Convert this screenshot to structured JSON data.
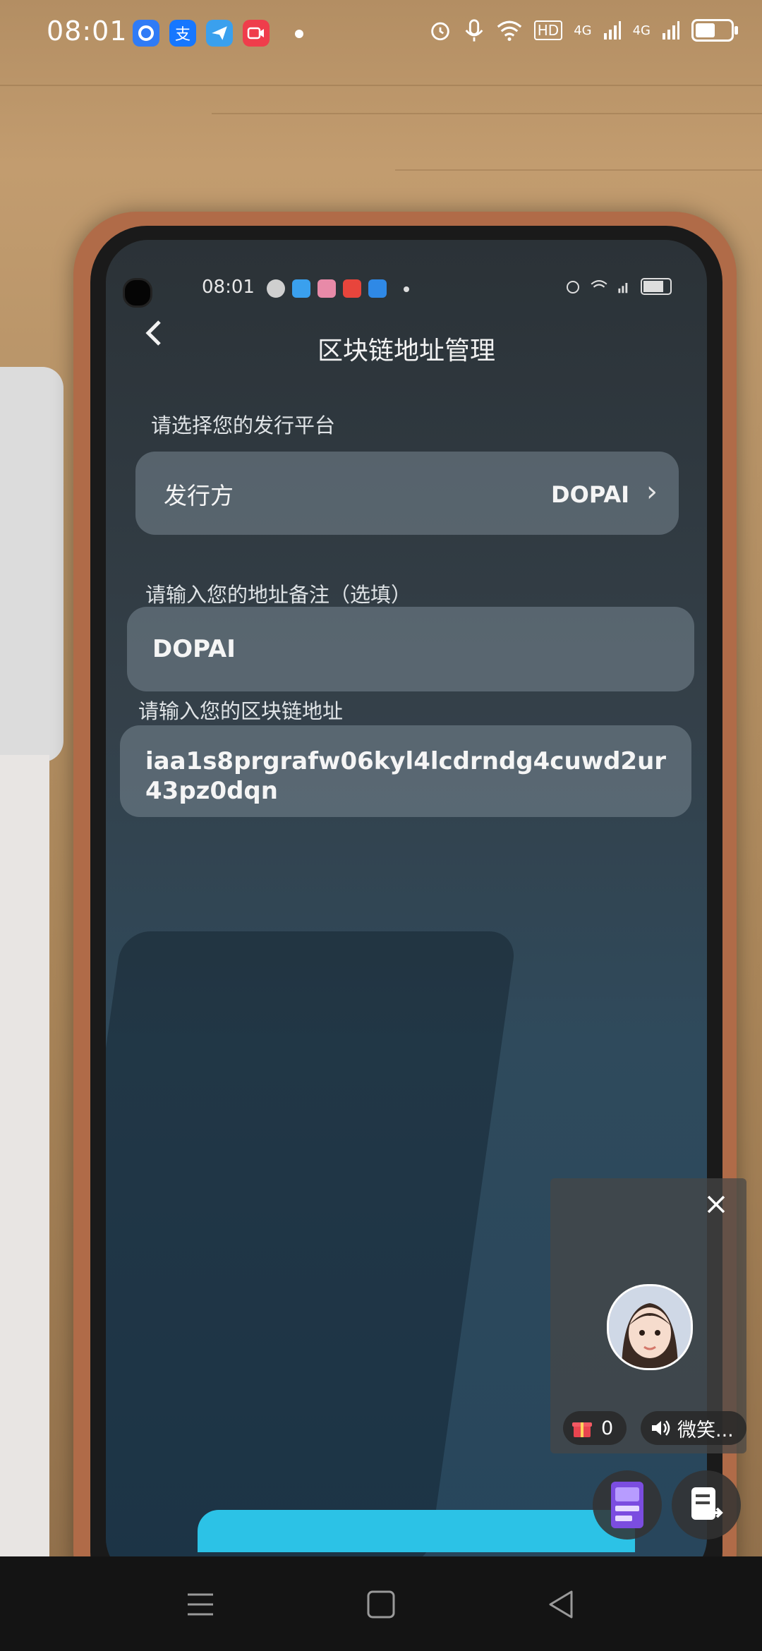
{
  "status_bar": {
    "time": "08:01",
    "apps": [
      {
        "icon": "circle-app-icon",
        "color": "#2f7bf6"
      },
      {
        "icon": "alipay-icon",
        "color": "#1677ff"
      },
      {
        "icon": "plane-app-icon",
        "color": "#3aa0ee"
      },
      {
        "icon": "video-app-icon",
        "color": "#ef3d4b"
      }
    ],
    "right_icons": [
      "alarm-icon",
      "mic-icon",
      "wifi-icon"
    ],
    "hd_badge": "HD",
    "network_1": "4G",
    "network_2": "4G"
  },
  "inner_phone": {
    "status_time": "08:01",
    "header": {
      "title": "区块链地址管理"
    },
    "platform_section": {
      "label": "请选择您的发行平台",
      "row_key": "发行方",
      "row_value": "DOPAI"
    },
    "note_section": {
      "label": "请输入您的地址备注（选填）",
      "value": "DOPAI"
    },
    "address_section": {
      "label": "请输入您的区块链地址",
      "value": "iaa1s8prgrafw06kyl4lcdrndg4cuwd2ur43pz0dqn"
    }
  },
  "overlay": {
    "gift_count": "0",
    "voice_label": "微笑..."
  }
}
